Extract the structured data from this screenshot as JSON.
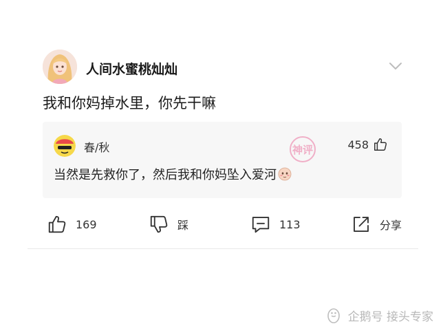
{
  "post": {
    "username": "人间水蜜桃灿灿",
    "text": "我和你妈掉水里，你先干嘛"
  },
  "hot_comment": {
    "name": "春/秋",
    "likes": "458",
    "text": "当然是先救你了，然后我和你妈坠入爱河",
    "stamp_text": "神评"
  },
  "actions": {
    "like_count": "169",
    "dislike_label": "踩",
    "comment_count": "113",
    "share_label": "分享"
  },
  "watermark": {
    "text": "企鹅号 接头专家"
  },
  "icons": {
    "expand": "chevron-down-icon",
    "like": "thumbs-up-icon",
    "dislike": "thumbs-down-icon",
    "comment": "comment-icon",
    "share": "share-icon"
  },
  "colors": {
    "stamp": "#e85a8f",
    "icon": "#333333"
  }
}
